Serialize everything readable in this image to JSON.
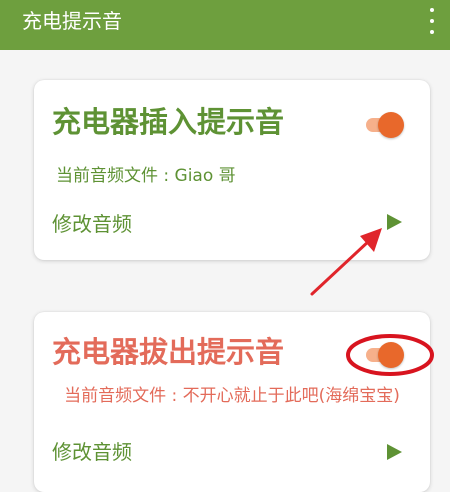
{
  "appbar": {
    "title": "充电提示音",
    "menu_icon": "more-vert-icon",
    "background": "#6e9f3e"
  },
  "cards": [
    {
      "title": "充电器插入提示音",
      "toggle_on": true,
      "file_label": "当前音频文件 : Giao 哥",
      "edit_label": "修改音频",
      "play_icon": "play-icon",
      "accent": "#5e9234"
    },
    {
      "title": "充电器拔出提示音",
      "toggle_on": true,
      "file_label": "当前音频文件 : 不开心就止于此吧(海绵宝宝)",
      "edit_label": "修改音频",
      "play_icon": "play-icon",
      "accent": "#e36b5a"
    }
  ],
  "annotations": {
    "arrow_color": "#e0252b",
    "circle_color": "#d8141f"
  },
  "colors": {
    "toggle_thumb": "#e8682b",
    "toggle_track": "#f6b08b",
    "play_green": "#5e9234"
  }
}
